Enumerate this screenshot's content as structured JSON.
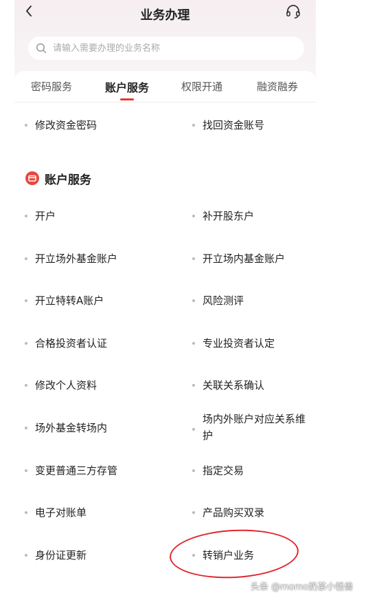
{
  "header": {
    "title": "业务办理",
    "back_icon": "back-chevron-icon",
    "service_icon": "headset-icon"
  },
  "search": {
    "placeholder": "请输入需要办理的业务名称",
    "icon": "search-icon"
  },
  "tabs": [
    {
      "label": "密码服务",
      "active": false
    },
    {
      "label": "账户服务",
      "active": true
    },
    {
      "label": "权限开通",
      "active": false
    },
    {
      "label": "融资融券",
      "active": false
    }
  ],
  "password_items": [
    "修改资金密码",
    "找回资金账号"
  ],
  "section": {
    "title": "账户服务",
    "icon": "card-icon",
    "accent": "#e8473f"
  },
  "account_items": [
    "开户",
    "补开股东户",
    "开立场外基金账户",
    "开立场内基金账户",
    "开立特转A账户",
    "风险测评",
    "合格投资者认证",
    "专业投资者认定",
    "修改个人资料",
    "关联关系确认",
    "场外基金转场内",
    "场内外账户对应关系维护",
    "变更普通三方存管",
    "指定交易",
    "电子对账单",
    "产品购买双录",
    "身份证更新",
    "转销户业务"
  ],
  "watermark": "头条 @momo奶茶小怪兽",
  "colors": {
    "active_tab_underline": "#e33a32",
    "annotation_circle": "#e0262e"
  }
}
